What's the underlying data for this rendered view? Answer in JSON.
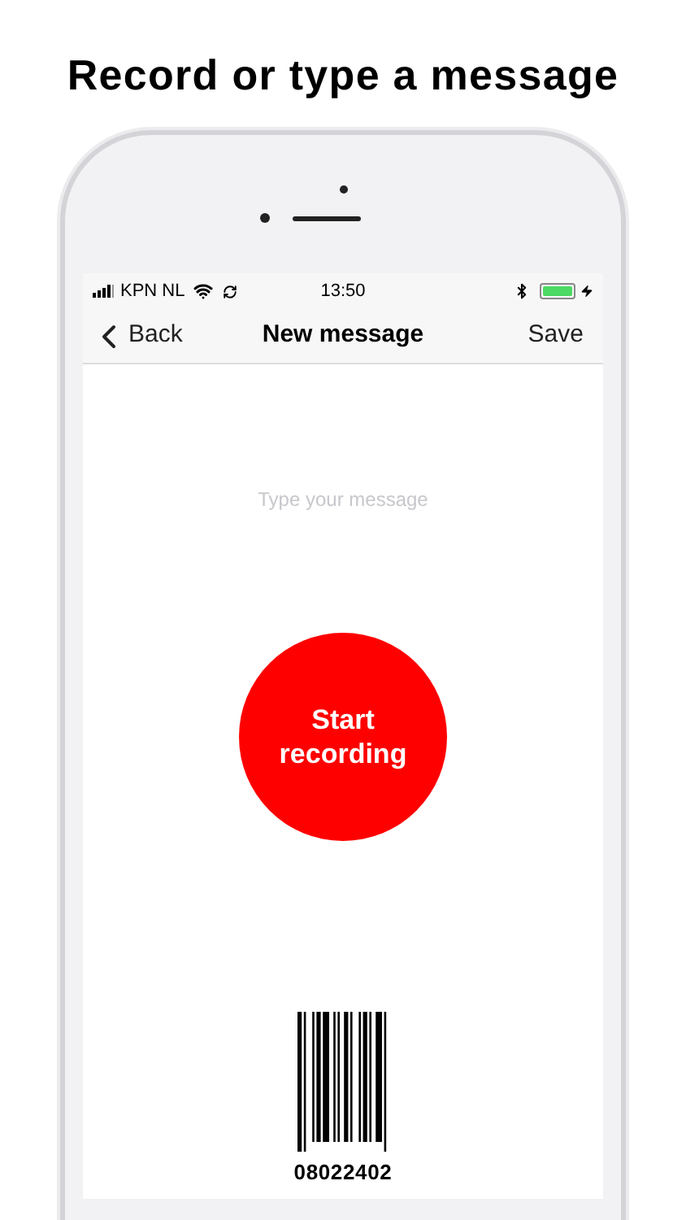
{
  "headline": "Record or type a message",
  "status_bar": {
    "carrier": "KPN NL",
    "time": "13:50"
  },
  "nav": {
    "back": "Back",
    "title": "New message",
    "save": "Save"
  },
  "message_field": {
    "placeholder": "Type your message"
  },
  "record_button": {
    "label": "Start recording"
  },
  "barcode": {
    "number": "08022402"
  }
}
